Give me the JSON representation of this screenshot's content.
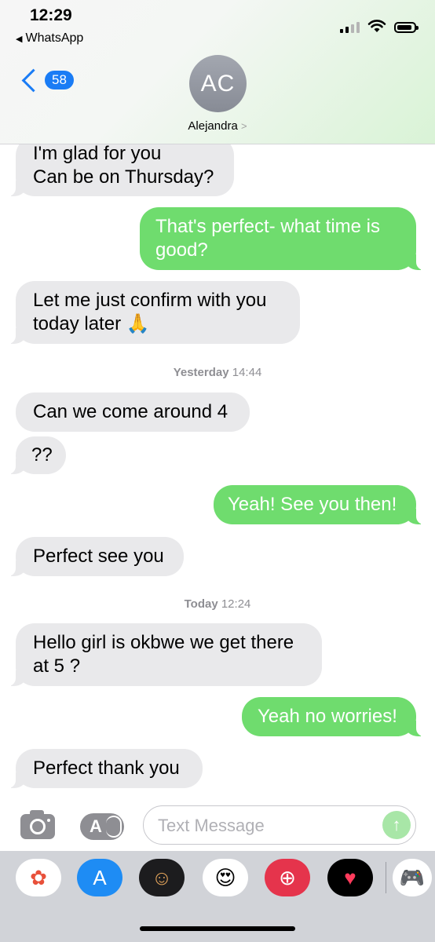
{
  "status_bar": {
    "time": "12:29",
    "back_app": "WhatsApp"
  },
  "header": {
    "back_count": "58",
    "avatar_initials": "AC",
    "contact_name": "Alejandra"
  },
  "messages": [
    {
      "dir": "in",
      "text": "I'm glad for you\nCan be on Thursday?"
    },
    {
      "dir": "out",
      "text": "That's perfect- what time is\ngood?"
    },
    {
      "dir": "in",
      "text": "Let me just confirm with you\ntoday later 🙏"
    },
    {
      "dir": "in",
      "text": "Can we come around 4"
    },
    {
      "dir": "in",
      "text": "??"
    },
    {
      "dir": "out",
      "text": "Yeah! See you then!"
    },
    {
      "dir": "in",
      "text": "Perfect see you"
    },
    {
      "dir": "in",
      "text": "Hello girl is okbwe we get there\nat 5 ?"
    },
    {
      "dir": "out",
      "text": "Yeah no worries!"
    },
    {
      "dir": "in",
      "text": "Perfect thank you"
    }
  ],
  "timestamps": [
    {
      "day": "Yesterday",
      "time": "14:44"
    },
    {
      "day": "Today",
      "time": "12:24"
    }
  ],
  "composer": {
    "placeholder": "Text Message",
    "send_icon": "↑"
  },
  "app_drawer": [
    {
      "name": "photos-app-icon",
      "glyph": "✿",
      "bg": "#ffffff",
      "color": "#e8503a"
    },
    {
      "name": "app-store-icon",
      "glyph": "A",
      "bg": "#1e8cf4",
      "color": "#ffffff"
    },
    {
      "name": "memoji-icon",
      "glyph": "☺",
      "bg": "#1c1c1e",
      "color": "#e0a25a"
    },
    {
      "name": "memoji-stickers-icon",
      "glyph": "😍",
      "bg": "#ffffff",
      "color": "#000000"
    },
    {
      "name": "search-images-icon",
      "glyph": "⊕",
      "bg": "#e5344c",
      "color": "#ffffff"
    },
    {
      "name": "digital-touch-icon",
      "glyph": "♥",
      "bg": "#000000",
      "color": "#ff3b5c"
    },
    {
      "name": "game-pigeon-icon",
      "glyph": "🎮",
      "bg": "#ffffff",
      "color": "#000000"
    }
  ]
}
